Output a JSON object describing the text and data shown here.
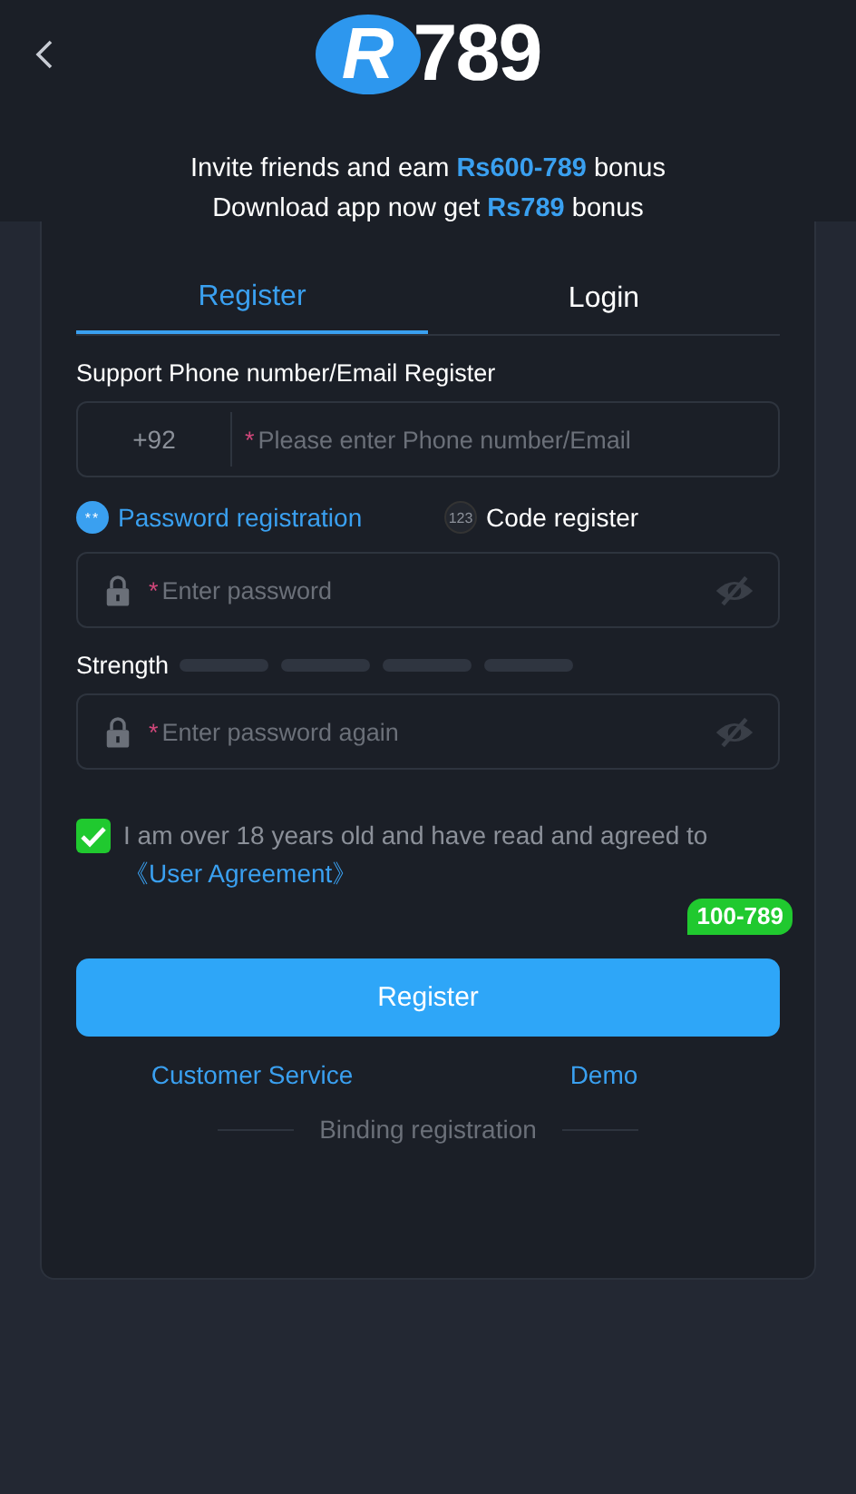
{
  "logo": {
    "letter": "R",
    "digits": "789"
  },
  "intro": [
    "Invite friends and eam **Rs600-789** bonus",
    "Download app now get **Rs789** bonus"
  ],
  "tabs": [
    {
      "label": "Register",
      "selected": true
    },
    {
      "label": "Login",
      "selected": false
    }
  ],
  "account": {
    "label": "Support Phone number/Email Register",
    "prefix": "+92",
    "required_mark": "*",
    "placeholder": "Please enter Phone number/Email"
  },
  "methods": [
    {
      "kind": "password",
      "icon_text": "**",
      "label": "Password registration",
      "selected": true
    },
    {
      "kind": "code",
      "icon_text": "123",
      "label": "Code register",
      "selected": false
    }
  ],
  "password": {
    "required_mark": "*",
    "placeholder": "Enter password"
  },
  "strength": {
    "label": "Strength"
  },
  "password_again": {
    "required_mark": "*",
    "placeholder": "Enter password again"
  },
  "agreement": {
    "checked": true,
    "text": "I am over 18 years old and have read and agreed to",
    "link": "《User Agreement》"
  },
  "badge": "100-789",
  "submit": "Register",
  "links": [
    "Customer Service",
    "Demo"
  ],
  "binding": "Binding registration"
}
